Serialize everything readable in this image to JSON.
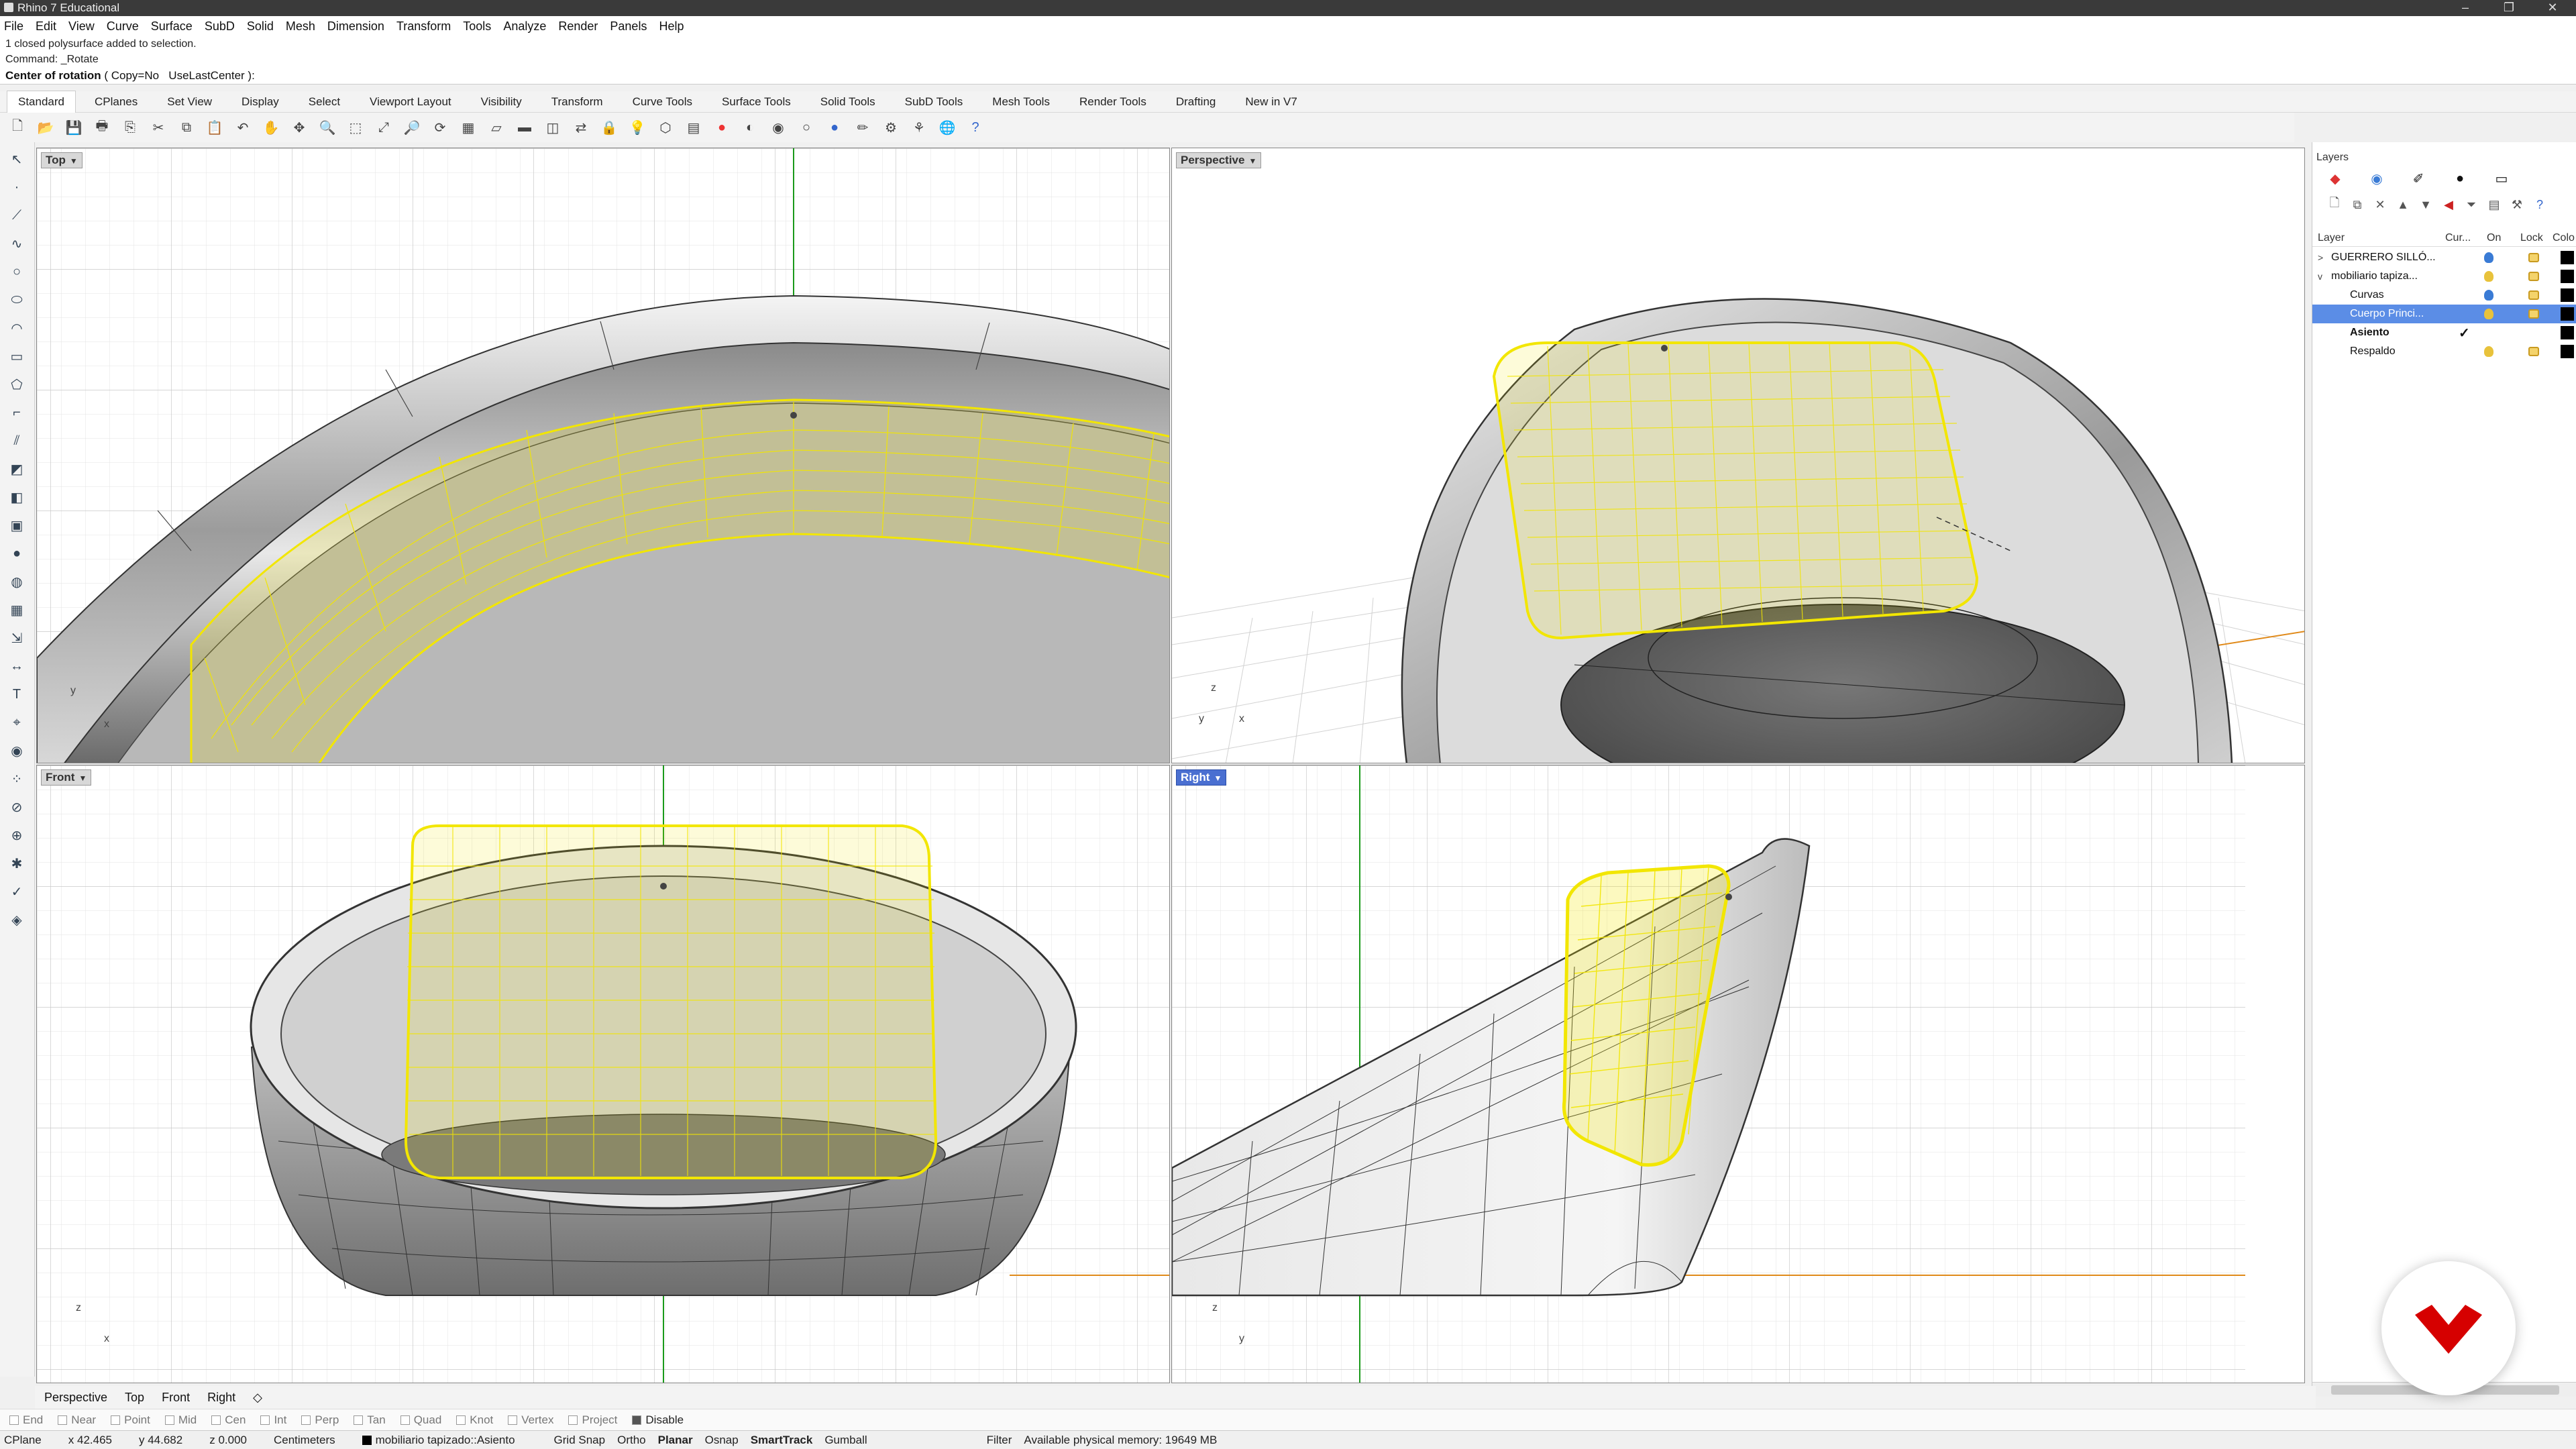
{
  "window": {
    "title": "Rhino 7 Educational"
  },
  "menu": [
    "File",
    "Edit",
    "View",
    "Curve",
    "Surface",
    "SubD",
    "Solid",
    "Mesh",
    "Dimension",
    "Transform",
    "Tools",
    "Analyze",
    "Render",
    "Panels",
    "Help"
  ],
  "command_history": [
    "1 closed polysurface added to selection.",
    "Command: _Rotate"
  ],
  "command_prompt": {
    "label": "Center of rotation",
    "options_open": "( ",
    "copy": "Copy=No",
    "uselast": "UseLastCenter",
    "options_close": " ):"
  },
  "toolbar_tabs": [
    "Standard",
    "CPlanes",
    "Set View",
    "Display",
    "Select",
    "Viewport Layout",
    "Visibility",
    "Transform",
    "Curve Tools",
    "Surface Tools",
    "Solid Tools",
    "SubD Tools",
    "Mesh Tools",
    "Render Tools",
    "Drafting",
    "New in V7"
  ],
  "viewports": {
    "top": {
      "label": "Top",
      "axis_y": "y",
      "axis_x": "x"
    },
    "perspective": {
      "label": "Perspective",
      "axis_z": "z",
      "axis_y": "y",
      "axis_x": "x"
    },
    "front": {
      "label": "Front",
      "axis_z": "z",
      "axis_x": "x"
    },
    "right": {
      "label": "Right",
      "axis_z": "z",
      "axis_y": "y"
    }
  },
  "viewport_tabs": [
    "Perspective",
    "Top",
    "Front",
    "Right"
  ],
  "layers": {
    "panel_title": "Layers",
    "columns": [
      "Layer",
      "Cur...",
      "On",
      "Lock",
      "Colo"
    ],
    "rows": [
      {
        "name": "GUERRERO SILLÓ...",
        "expander": ">"
      },
      {
        "name": "mobiliario tapiza...",
        "expander": "v"
      },
      {
        "name": "Curvas"
      },
      {
        "name": "Cuerpo Princi..."
      },
      {
        "name": "Asiento",
        "current": "✓"
      },
      {
        "name": "Respaldo"
      }
    ]
  },
  "osnaps": [
    {
      "label": "End",
      "on": false
    },
    {
      "label": "Near",
      "on": false
    },
    {
      "label": "Point",
      "on": false
    },
    {
      "label": "Mid",
      "on": false
    },
    {
      "label": "Cen",
      "on": false
    },
    {
      "label": "Int",
      "on": false
    },
    {
      "label": "Perp",
      "on": false
    },
    {
      "label": "Tan",
      "on": false
    },
    {
      "label": "Quad",
      "on": false
    },
    {
      "label": "Knot",
      "on": false
    },
    {
      "label": "Vertex",
      "on": false
    },
    {
      "label": "Project",
      "on": false
    },
    {
      "label": "Disable",
      "on": true
    }
  ],
  "status": {
    "cplane": "CPlane",
    "x": "x 42.465",
    "y": "y 44.682",
    "z": "z 0.000",
    "units": "Centimeters",
    "layer": "mobiliario tapizado::Asiento",
    "grid_snap": "Grid Snap",
    "ortho": "Ortho",
    "planar": "Planar",
    "osnap": "Osnap",
    "smarttrack": "SmartTrack",
    "gumball": "Gumball",
    "filter": "Filter",
    "memory": "Available physical memory: 19649 MB"
  },
  "colors": {
    "selection": "#f2e600",
    "active_viewport": "#4a6fd1",
    "layer_selected": "#5b8de6",
    "brand": "#d60000"
  }
}
